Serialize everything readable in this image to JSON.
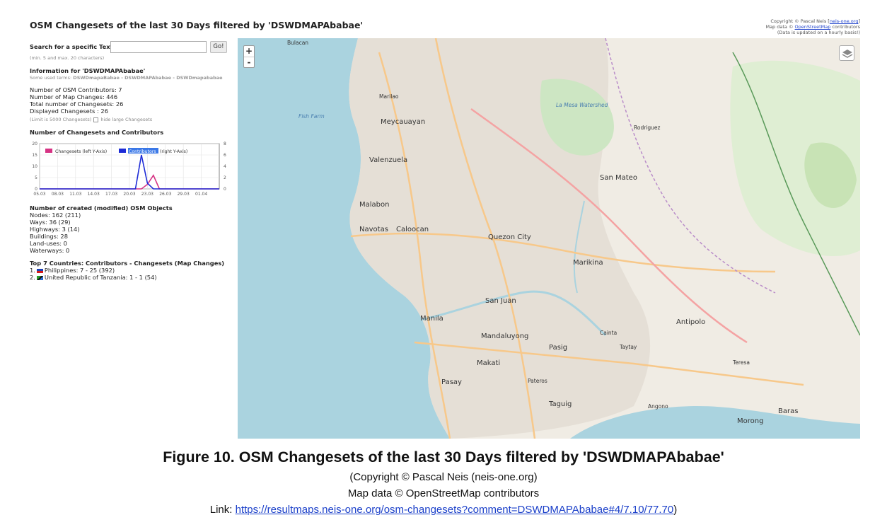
{
  "header": {
    "title": "OSM Changesets of the last 30 Days filtered by 'DSWDMAPAbabae'",
    "copyright": "Copyright © Pascal Neis",
    "copyright_link": "neis-one.org",
    "mapdata": "Map data ©",
    "mapdata_link": "OpenStreetMap",
    "mapdata_suffix": "contributors",
    "update_note": "(Data is updated on a hourly basis!)"
  },
  "search": {
    "label": "Search for a specific Text:",
    "value": "",
    "placeholder": "",
    "go_label": "Go!",
    "hint": "(min. 5 and max. 20 characters)"
  },
  "info": {
    "title": "Information for 'DSWDMAPAbabae'",
    "terms_label": "Some used terms:",
    "terms": "DSWDmapaBabae - DSWDMAPAbabae - DSWDmapababae",
    "contributors": "Number of OSM Contributors: 7",
    "map_changes": "Number of Map Changes: 446",
    "total_changesets": "Total number of Changesets: 26",
    "displayed_changesets": "Displayed Changesets : 26",
    "limit": "(Limit is 5000 Changesets)",
    "hide_large": "hide large Changesets"
  },
  "chart_section": {
    "title": "Number of Changesets and Contributors"
  },
  "chart_data": {
    "type": "line",
    "title": "Number of Changesets and Contributors",
    "x": [
      "05.03",
      "06.03",
      "07.03",
      "08.03",
      "09.03",
      "10.03",
      "11.03",
      "12.03",
      "13.03",
      "14.03",
      "15.03",
      "16.03",
      "17.03",
      "18.03",
      "19.03",
      "20.03",
      "21.03",
      "22.03",
      "23.03",
      "24.03",
      "25.03",
      "26.03",
      "27.03",
      "28.03",
      "29.03",
      "30.03",
      "31.03",
      "01.04",
      "02.04",
      "03.04",
      "04.04"
    ],
    "x_tick_labels": [
      "05.03",
      "08.03",
      "11.03",
      "14.03",
      "17.03",
      "20.03",
      "23.03",
      "26.03",
      "29.03",
      "01.04"
    ],
    "series": [
      {
        "name": "Changesets (left Y-Axis)",
        "axis": "left",
        "color": "#d63384",
        "values": [
          0,
          0,
          0,
          0,
          0,
          0,
          0,
          0,
          0,
          0,
          0,
          0,
          0,
          0,
          0,
          0,
          0,
          0,
          2,
          6,
          0,
          0,
          0,
          0,
          0,
          0,
          0,
          0,
          0,
          0,
          0
        ]
      },
      {
        "name": "Contributors",
        "axis": "right",
        "color": "#1d2bd6",
        "values": [
          0,
          0,
          0,
          0,
          0,
          0,
          0,
          0,
          0,
          0,
          0,
          0,
          0,
          0,
          0,
          0,
          0,
          6,
          1,
          0,
          0,
          0,
          0,
          0,
          0,
          0,
          0,
          0,
          0,
          0,
          0
        ]
      }
    ],
    "legend_label_changesets": "Changesets (left Y-Axis)",
    "legend_label_contributors": "Contributors",
    "legend_label_contributors_suffix": "(right Y-Axis)",
    "y_left": {
      "ticks": [
        0,
        5,
        10,
        15,
        20
      ],
      "ylim": [
        0,
        20
      ]
    },
    "y_right": {
      "ticks": [
        0,
        2,
        4,
        6,
        8
      ],
      "ylim": [
        0,
        8
      ]
    },
    "grid": true,
    "legend_position": "top"
  },
  "objects": {
    "title": "Number of created (modified) OSM Objects",
    "nodes": "Nodes: 162 (211)",
    "ways": "Ways: 36 (29)",
    "highways": "Highways: 3 (14)",
    "buildings": "Buildings: 28",
    "landuses": "Land-uses: 0",
    "waterways": "Waterways: 0"
  },
  "countries": {
    "title": "Top 7 Countries: Contributors - Changesets (Map Changes)",
    "items": [
      {
        "num": "1.",
        "text": "Philippines: 7 - 25 (392)"
      },
      {
        "num": "2.",
        "text": "United Republic of Tanzania: 1 - 1 (54)"
      }
    ]
  },
  "map": {
    "zoom_in": "+",
    "zoom_out": "-",
    "labels": [
      {
        "text": "Bulacan"
      },
      {
        "text": "Malabon"
      },
      {
        "text": "Navotas"
      },
      {
        "text": "Caloocan"
      },
      {
        "text": "Valenzuela"
      },
      {
        "text": "Meycauayan"
      },
      {
        "text": "Quezon City"
      },
      {
        "text": "Marikina"
      },
      {
        "text": "Manila"
      },
      {
        "text": "San Juan"
      },
      {
        "text": "Mandaluyong"
      },
      {
        "text": "Pasig"
      },
      {
        "text": "Makati"
      },
      {
        "text": "Pasay"
      },
      {
        "text": "Taguig"
      },
      {
        "text": "Pateros"
      },
      {
        "text": "Cainta"
      },
      {
        "text": "Taytay"
      },
      {
        "text": "Antipolo"
      },
      {
        "text": "San Mateo"
      },
      {
        "text": "Rodriguez"
      },
      {
        "text": "Angono"
      },
      {
        "text": "Baras"
      },
      {
        "text": "Morong"
      },
      {
        "text": "Teresa"
      },
      {
        "text": "Marilao"
      },
      {
        "text": "Fish Farm"
      },
      {
        "text": "La Mesa Watershed"
      }
    ]
  },
  "caption": {
    "figure": "Figure 10. OSM Changesets of the last 30 Days filtered by 'DSWDMAPAbabae'",
    "line1": "(Copyright © Pascal Neis (neis-one.org)",
    "line2": "Map data © OpenStreetMap contributors",
    "line3_prefix": "Link: ",
    "line3_url": "https://resultmaps.neis-one.org/osm-changesets?comment=DSWDMAPAbabae#4/7.10/77.70",
    "line3_suffix": ")"
  }
}
